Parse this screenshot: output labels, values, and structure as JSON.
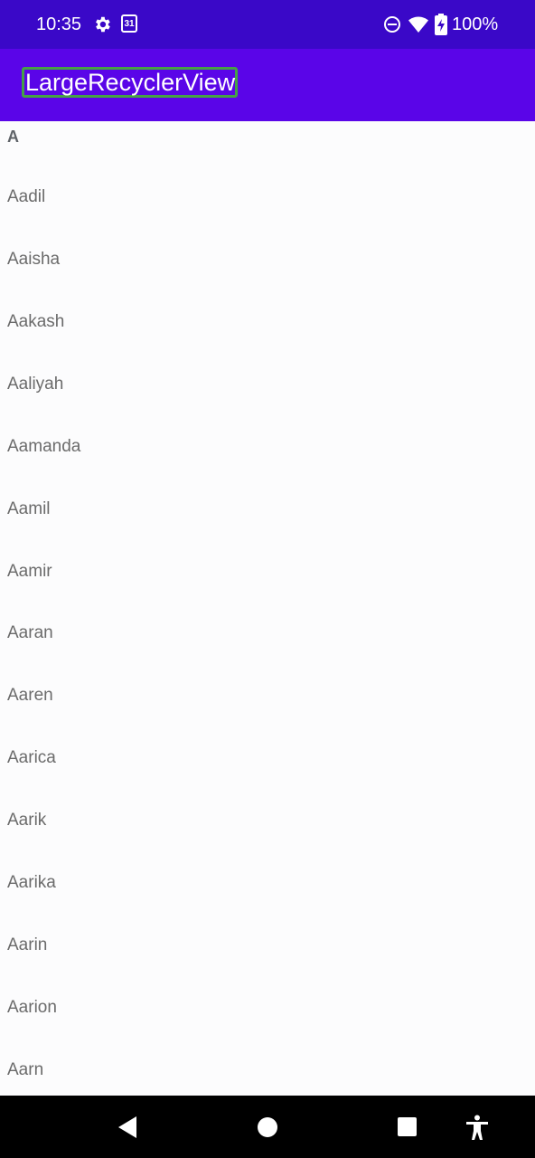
{
  "status_bar": {
    "time": "10:35",
    "calendar_day": "31",
    "battery_pct": "100%",
    "icons": [
      "gear-icon",
      "calendar-icon",
      "do-not-disturb-icon",
      "wifi-icon",
      "battery-charging-icon"
    ]
  },
  "app_bar": {
    "title": "LargeRecyclerView",
    "background": "#5a05e8"
  },
  "list": {
    "section_header": "A",
    "items": [
      "Aadil",
      "Aaisha",
      "Aakash",
      "Aaliyah",
      "Aamanda",
      "Aamil",
      "Aamir",
      "Aaran",
      "Aaren",
      "Aarica",
      "Aarik",
      "Aarika",
      "Aarin",
      "Aarion",
      "Aarn"
    ]
  },
  "nav_bar": {
    "icons": [
      "back-icon",
      "home-icon",
      "recents-icon",
      "accessibility-icon"
    ]
  },
  "colors": {
    "status_bar": "#3a08c8",
    "title_highlight_border": "#46a046",
    "item_text": "#6b6b6b"
  }
}
